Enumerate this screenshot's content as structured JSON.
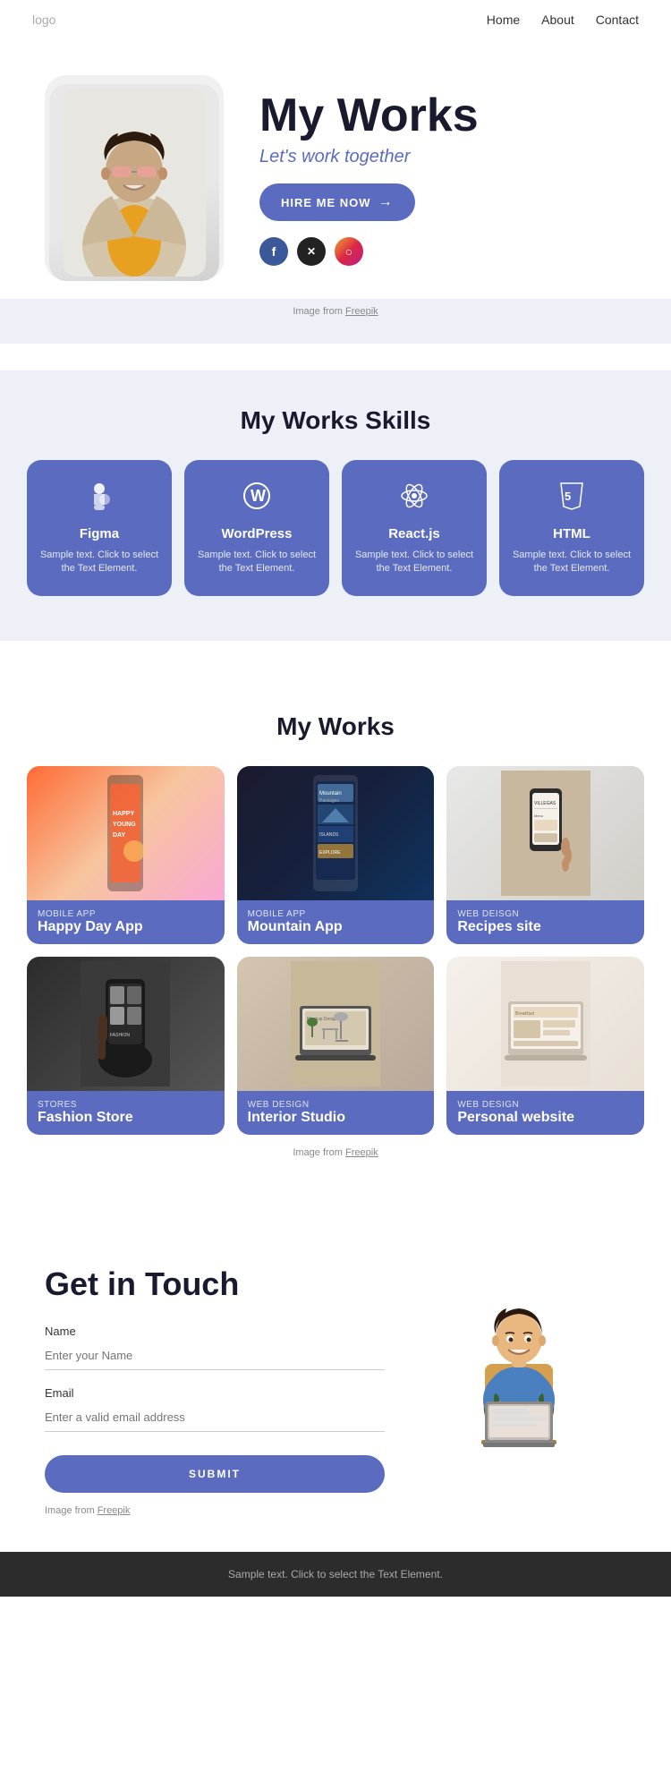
{
  "nav": {
    "logo": "logo",
    "links": [
      "Home",
      "About",
      "Contact"
    ]
  },
  "hero": {
    "title": "My Works",
    "subtitle": "Let's work together",
    "hire_btn": "HIRE ME NOW",
    "image_caption": "Image from Freepik",
    "social": [
      {
        "name": "Facebook",
        "symbol": "f"
      },
      {
        "name": "X",
        "symbol": "✕"
      },
      {
        "name": "Instagram",
        "symbol": "◎"
      }
    ]
  },
  "skills": {
    "section_title": "My Works Skills",
    "cards": [
      {
        "name": "Figma",
        "icon": "Ⅎ",
        "desc": "Sample text. Click to select the Text Element."
      },
      {
        "name": "WordPress",
        "icon": "⊕",
        "desc": "Sample text. Click to select the Text Element."
      },
      {
        "name": "React.js",
        "icon": "⚛",
        "desc": "Sample text. Click to select the Text Element."
      },
      {
        "name": "HTML",
        "icon": "⑤",
        "desc": "Sample text. Click to select the Text Element."
      }
    ]
  },
  "works": {
    "section_title": "My Works",
    "items": [
      {
        "category": "MOBILE APP",
        "name": "Happy Day App",
        "bg_class": "mock-happy"
      },
      {
        "category": "MOBILE APP",
        "name": "Mountain App",
        "bg_class": "mock-mountain"
      },
      {
        "category": "WEB DEISGN",
        "name": "Recipes site",
        "bg_class": "mock-recipes"
      },
      {
        "category": "STORES",
        "name": "Fashion Store",
        "bg_class": "mock-fashion"
      },
      {
        "category": "WEB DESIGN",
        "name": "Interior Studio",
        "bg_class": "mock-interior"
      },
      {
        "category": "WEB DESIGN",
        "name": "Personal website",
        "bg_class": "mock-personal"
      }
    ],
    "caption": "Image from Freepik"
  },
  "contact": {
    "title": "Get in Touch",
    "name_label": "Name",
    "name_placeholder": "Enter your Name",
    "email_label": "Email",
    "email_placeholder": "Enter a valid email address",
    "submit_label": "SUBMIT",
    "caption": "Image from Freepik"
  },
  "footer": {
    "text": "Sample text. Click to select the Text Element."
  }
}
